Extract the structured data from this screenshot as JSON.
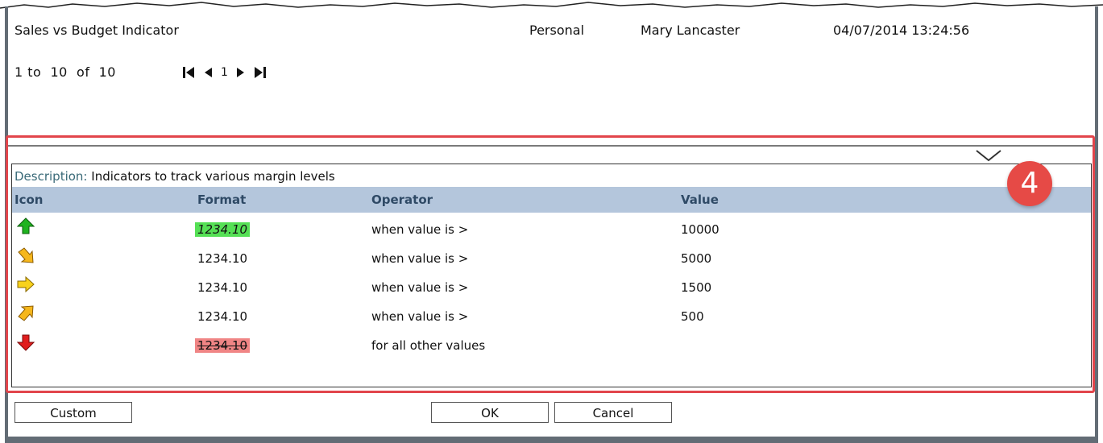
{
  "header": {
    "report_title": "Sales vs Budget Indicator",
    "scope": "Personal",
    "user": "Mary Lancaster",
    "timestamp": "04/07/2014 13:24:56"
  },
  "pager": {
    "range_text": "1 to  10  of  10",
    "page": "1",
    "icons": [
      "first-page-icon",
      "previous-page-icon",
      "next-page-icon",
      "last-page-icon"
    ]
  },
  "panel": {
    "description_label": "Description:",
    "description_text": "Indicators to track various margin levels",
    "columns": [
      "Icon",
      "Format",
      "Operator",
      "Value"
    ],
    "rows": [
      {
        "icon": "green-up-arrow-icon",
        "format": "1234.10",
        "operator": "when value is >",
        "value": "10000"
      },
      {
        "icon": "orange-down-right-arrow-icon",
        "format": "1234.10",
        "operator": "when value is >",
        "value": "5000"
      },
      {
        "icon": "yellow-right-arrow-icon",
        "format": "1234.10",
        "operator": "when value is >",
        "value": "1500"
      },
      {
        "icon": "orange-up-right-arrow-icon",
        "format": "1234.10",
        "operator": "when value is >",
        "value": "500"
      },
      {
        "icon": "red-down-arrow-icon",
        "format": "1234.10",
        "operator": "for all other values",
        "value": ""
      }
    ]
  },
  "callout": {
    "number": "4",
    "color": "#e64a46"
  },
  "buttons": {
    "custom": "Custom",
    "ok": "OK",
    "cancel": "Cancel"
  },
  "colors": {
    "header_band": "#b4c6dc",
    "format_green": "#55e055",
    "format_red": "#f08585",
    "highlight_outline": "#e2454b"
  }
}
